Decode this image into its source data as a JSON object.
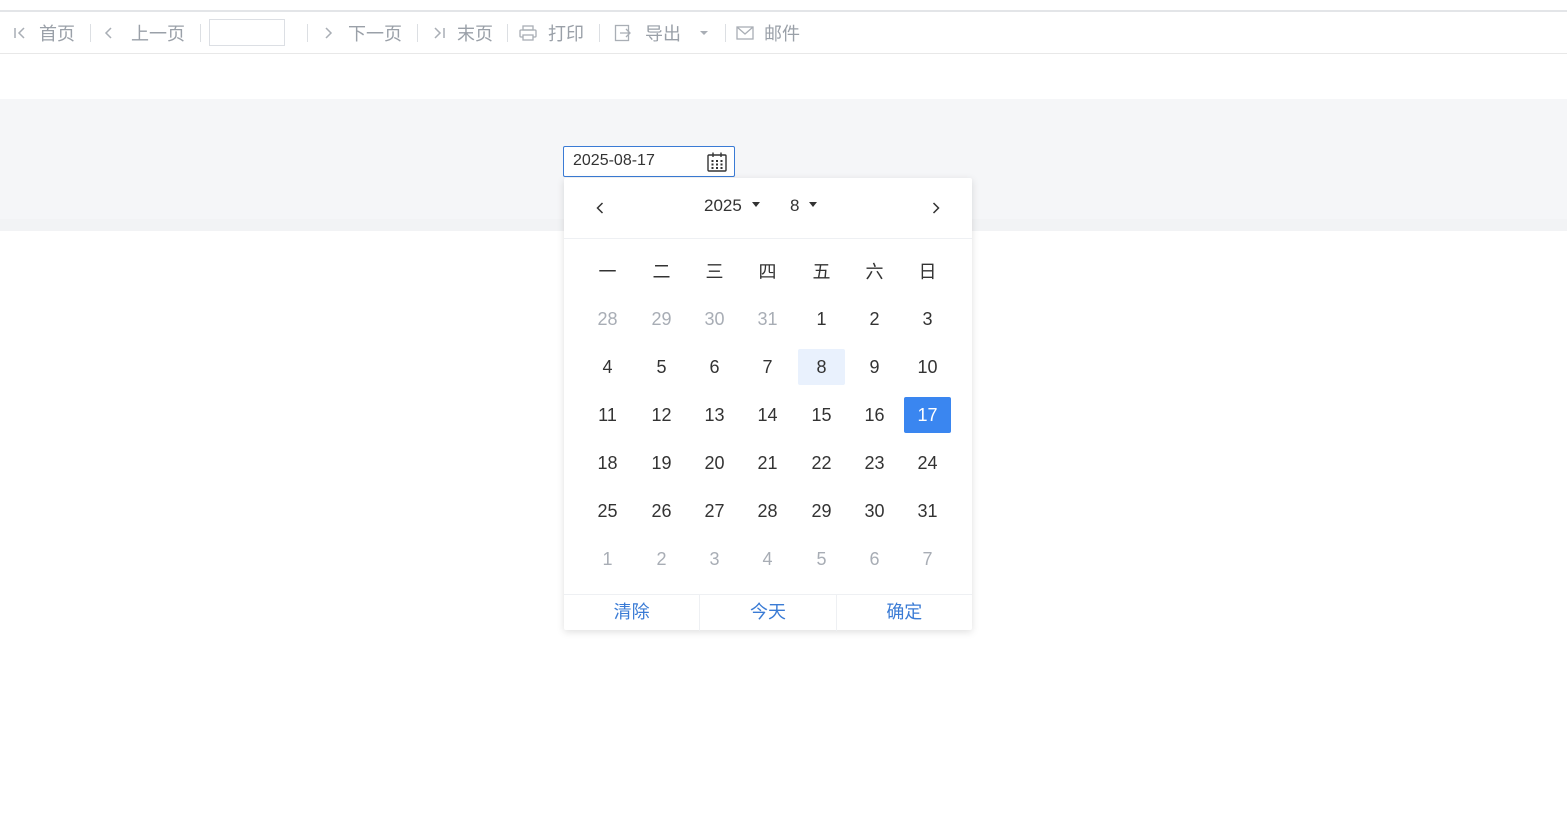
{
  "toolbar": {
    "first_label": "首页",
    "prev_label": "上一页",
    "page_value": "",
    "next_label": "下一页",
    "last_label": "末页",
    "print_label": "打印",
    "export_label": "导出",
    "mail_label": "邮件"
  },
  "date_input": {
    "value": "2025-08-17"
  },
  "picker": {
    "year": "2025",
    "month": "8",
    "weekdays": [
      "一",
      "二",
      "三",
      "四",
      "五",
      "六",
      "日"
    ],
    "weeks": [
      [
        "28",
        "29",
        "30",
        "31",
        "1",
        "2",
        "3"
      ],
      [
        "4",
        "5",
        "6",
        "7",
        "8",
        "9",
        "10"
      ],
      [
        "11",
        "12",
        "13",
        "14",
        "15",
        "16",
        "17"
      ],
      [
        "18",
        "19",
        "20",
        "21",
        "22",
        "23",
        "24"
      ],
      [
        "25",
        "26",
        "27",
        "28",
        "29",
        "30",
        "31"
      ],
      [
        "1",
        "2",
        "3",
        "4",
        "5",
        "6",
        "7"
      ]
    ],
    "footer": {
      "clear": "清除",
      "today": "今天",
      "confirm": "确定"
    }
  },
  "colors": {
    "accent": "#3a86f0",
    "today_bg": "#e9f1fd",
    "muted": "#9aa0a8"
  }
}
